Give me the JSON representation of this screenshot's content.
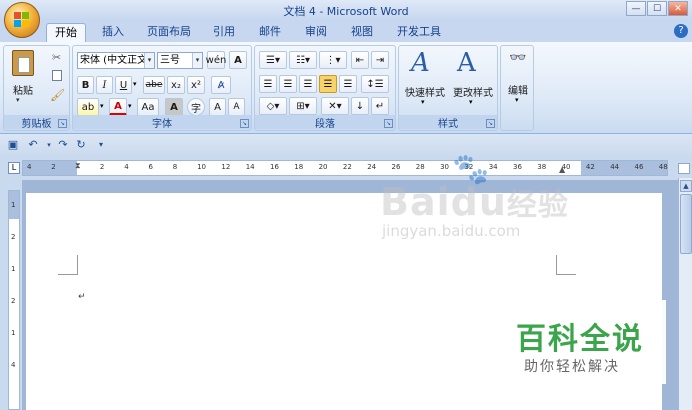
{
  "window": {
    "title": "文档 4 - Microsoft Word",
    "controls": [
      "—",
      "☐",
      "✕"
    ]
  },
  "tabs": [
    {
      "label": "开始",
      "active": true
    },
    {
      "label": "插入"
    },
    {
      "label": "页面布局"
    },
    {
      "label": "引用"
    },
    {
      "label": "邮件"
    },
    {
      "label": "审阅"
    },
    {
      "label": "视图"
    },
    {
      "label": "开发工具"
    }
  ],
  "ribbon": {
    "clipboard": {
      "label": "剪贴板",
      "paste": "粘贴"
    },
    "font": {
      "label": "字体",
      "font_name": "宋体 (中文正文",
      "font_size": "三号",
      "bold": "B",
      "italic": "I",
      "underline": "U",
      "strike": "abe",
      "subscript": "x₂",
      "superscript": "x²",
      "grow": "A",
      "shrink": "A",
      "change_case": "Aa"
    },
    "paragraph": {
      "label": "段落"
    },
    "styles": {
      "label": "样式",
      "quick": "快速样式",
      "change": "更改样式"
    },
    "editing": {
      "label": "编辑"
    }
  },
  "ruler": {
    "marks": [
      "4",
      "2",
      "",
      "2",
      "4",
      "6",
      "8",
      "10",
      "12",
      "14",
      "16",
      "18",
      "20",
      "22",
      "24",
      "26",
      "28",
      "30",
      "32",
      "34",
      "36",
      "38",
      "40",
      "42",
      "44",
      "46",
      "48"
    ]
  },
  "vruler": {
    "marks": [
      "1",
      "2",
      "1",
      "2",
      "1",
      "4"
    ]
  },
  "document": {
    "para_mark": "↵"
  },
  "watermark": {
    "baidu": "Bai",
    "baidu2": "du",
    "jingyan": "经验",
    "url": "jingyan.baidu.com",
    "title": "百科全说",
    "subtitle": "助你轻松解决"
  },
  "colors": {
    "accent": "#15428b",
    "ribbon_bg": "#dfeaf7",
    "green": "#3aa54a"
  }
}
